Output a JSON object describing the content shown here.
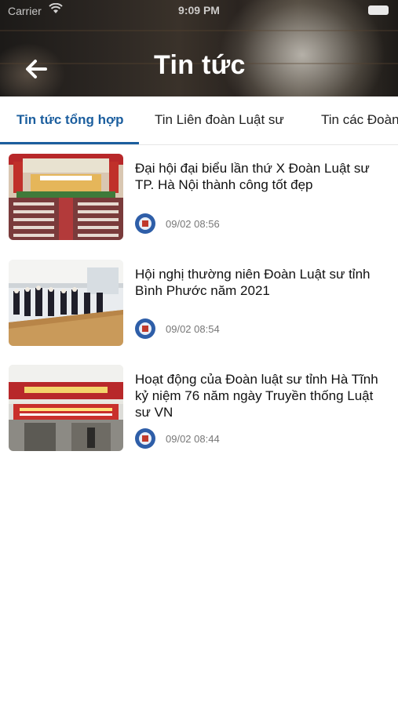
{
  "status_bar": {
    "carrier": "Carrier",
    "time": "9:09 PM"
  },
  "header": {
    "title": "Tin tức",
    "back_icon": "arrow-left-icon"
  },
  "tabs": [
    {
      "label": "Tin tức tổng hợp",
      "active": true
    },
    {
      "label": "Tin Liên đoàn Luật sư",
      "active": false
    },
    {
      "label": "Tin các Đoàn",
      "active": false
    }
  ],
  "news": [
    {
      "title": "Đại hội đại biểu lần thứ X Đoàn Luật sư TP. Hà Nội thành công tốt đẹp",
      "time": "09/02 08:56",
      "thumbnail": "conference-hall-photo"
    },
    {
      "title": "Hội nghị thường niên Đoàn Luật sư tỉnh Bình Phước năm 2021",
      "time": "09/02 08:54",
      "thumbnail": "meeting-room-photo"
    },
    {
      "title": "Hoạt động của Đoàn luật sư tỉnh Hà Tĩnh kỷ niệm 76 năm ngày Truyền thống Luật sư VN",
      "time": "09/02 08:44",
      "thumbnail": "law-office-storefront-photo"
    }
  ],
  "colors": {
    "accent": "#1b5e9e",
    "text": "#111111",
    "muted": "#777777"
  }
}
